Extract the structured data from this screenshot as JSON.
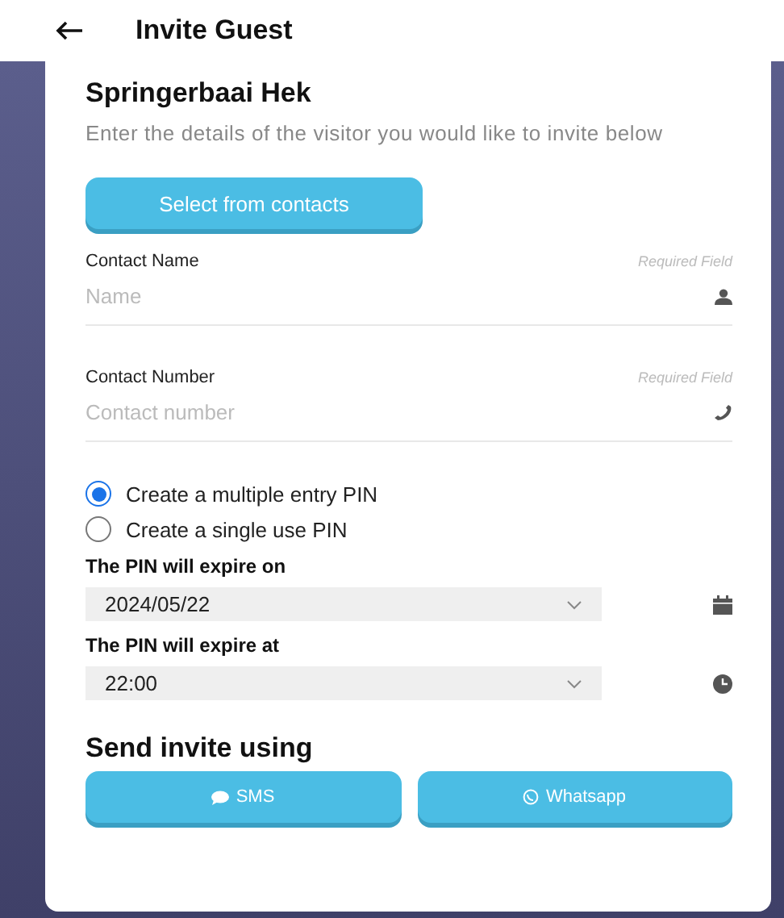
{
  "header": {
    "title": "Invite Guest"
  },
  "card": {
    "title": "Springerbaai Hek",
    "description": "Enter the details of the visitor you would like to invite below",
    "contacts_button": "Select from contacts"
  },
  "fields": [
    {
      "label": "Contact Name",
      "hint": "Required Field",
      "placeholder": "Name"
    },
    {
      "label": "Contact Number",
      "hint": "Required Field",
      "placeholder": "Contact number"
    }
  ],
  "pin_options": [
    {
      "label": "Create a multiple entry PIN",
      "selected": true
    },
    {
      "label": "Create a single use PIN",
      "selected": false
    }
  ],
  "expiry": [
    {
      "label": "The PIN will expire on",
      "value": "2024/05/22"
    },
    {
      "label": "The PIN will expire at",
      "value": "22:00"
    }
  ],
  "send": {
    "title": "Send invite using",
    "buttons": [
      "SMS",
      "Whatsapp"
    ]
  }
}
